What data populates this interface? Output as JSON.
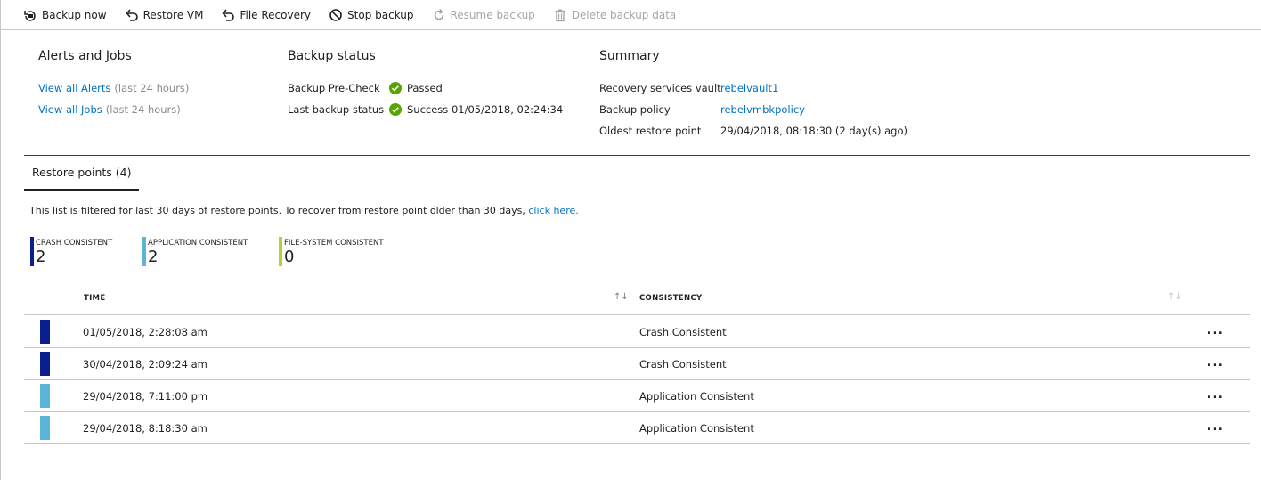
{
  "toolbar": {
    "backup_now": "Backup now",
    "restore_vm": "Restore VM",
    "file_recovery": "File Recovery",
    "stop_backup": "Stop backup",
    "resume_backup": "Resume backup",
    "delete_backup_data": "Delete backup data"
  },
  "alerts": {
    "title": "Alerts and Jobs",
    "view_alerts": "View all Alerts",
    "view_alerts_note": "(last 24 hours)",
    "view_jobs": "View all Jobs",
    "view_jobs_note": "(last 24 hours)"
  },
  "backup_status": {
    "title": "Backup status",
    "precheck_label": "Backup Pre-Check",
    "precheck_value": "Passed",
    "last_label": "Last backup status",
    "last_value": "Success 01/05/2018, 02:24:34"
  },
  "summary": {
    "title": "Summary",
    "vault_label": "Recovery services vault",
    "vault_value": "rebelvault1",
    "policy_label": "Backup policy",
    "policy_value": "rebelvmbkpolicy",
    "oldest_label": "Oldest restore point",
    "oldest_value": "29/04/2018, 08:18:30 (2 day(s) ago)"
  },
  "tab": {
    "label": "Restore points (4)"
  },
  "filter_note": {
    "text": "This list is filtered for last 30 days of restore points. To recover from restore point older than 30 days,",
    "link": "click here."
  },
  "counters": [
    {
      "label": "CRASH CONSISTENT",
      "value": "2",
      "color": "#0a1f8f"
    },
    {
      "label": "APPLICATION CONSISTENT",
      "value": "2",
      "color": "#5db4d9"
    },
    {
      "label": "FILE-SYSTEM CONSISTENT",
      "value": "0",
      "color": "#b4cf3a"
    }
  ],
  "table": {
    "headers": {
      "time": "TIME",
      "consistency": "CONSISTENCY"
    },
    "sort_time": "↑↓",
    "sort_consistency": "↑↓",
    "more": "...",
    "rows": [
      {
        "time": "01/05/2018, 2:28:08 am",
        "consistency": "Crash Consistent",
        "color": "#0a1f8f"
      },
      {
        "time": "30/04/2018, 2:09:24 am",
        "consistency": "Crash Consistent",
        "color": "#0a1f8f"
      },
      {
        "time": "29/04/2018, 7:11:00 pm",
        "consistency": "Application Consistent",
        "color": "#5db4d9"
      },
      {
        "time": "29/04/2018, 8:18:30 am",
        "consistency": "Application Consistent",
        "color": "#5db4d9"
      }
    ]
  }
}
